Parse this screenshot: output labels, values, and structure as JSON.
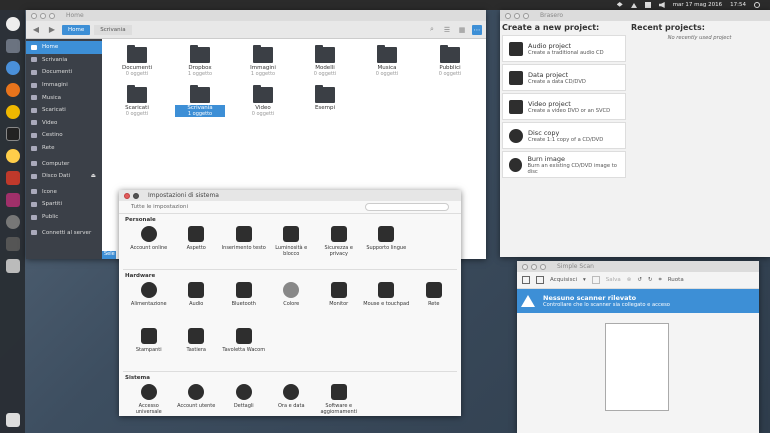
{
  "panel": {
    "date": "mar 17 mag 2016",
    "time": "17:54"
  },
  "files": {
    "title": "Home",
    "crumb_home": "Home",
    "crumb_desktop": "Scrivania",
    "sidebar": [
      "Home",
      "Scrivania",
      "Documenti",
      "Immagini",
      "Musica",
      "Scaricati",
      "Video",
      "Cestino",
      "Rete",
      "Computer",
      "Disco Dati",
      "Icone",
      "Spartiti",
      "Public",
      "Connetti al server"
    ],
    "items": [
      {
        "name": "Documenti",
        "sub": "0 oggetti"
      },
      {
        "name": "Dropbox",
        "sub": "1 oggetto"
      },
      {
        "name": "Immagini",
        "sub": "1 oggetto"
      },
      {
        "name": "Modelli",
        "sub": "0 oggetti"
      },
      {
        "name": "Musica",
        "sub": "0 oggetti"
      },
      {
        "name": "Pubblici",
        "sub": "0 oggetti"
      },
      {
        "name": "Scaricati",
        "sub": "0 oggetti"
      },
      {
        "name": "Scrivania",
        "sub": "1 oggetto"
      },
      {
        "name": "Video",
        "sub": "0 oggetti"
      },
      {
        "name": "Esempi",
        "sub": ""
      }
    ],
    "status": "Sele"
  },
  "brasero": {
    "title": "Brasero",
    "create_heading": "Create a new project:",
    "recent_heading": "Recent projects:",
    "recent_empty": "No recently used project",
    "projects": [
      {
        "title": "Audio project",
        "desc": "Create a traditional audio CD"
      },
      {
        "title": "Data project",
        "desc": "Create a data CD/DVD"
      },
      {
        "title": "Video project",
        "desc": "Create a video DVD or an SVCD"
      },
      {
        "title": "Disc copy",
        "desc": "Create 1:1 copy of a CD/DVD"
      },
      {
        "title": "Burn image",
        "desc": "Burn an existing CD/DVD image to disc"
      }
    ]
  },
  "settings": {
    "title": "Impostazioni di sistema",
    "all": "Tutte le impostazioni",
    "sections": [
      {
        "name": "Personale",
        "items": [
          "Account online",
          "Aspetto",
          "Inserimento testo",
          "Luminosità e blocco",
          "Sicurezza e privacy",
          "Supporto lingue"
        ]
      },
      {
        "name": "Hardware",
        "items": [
          "Alimentazione",
          "Audio",
          "Bluetooth",
          "Colore",
          "Monitor",
          "Mouse e touchpad",
          "Rete",
          "Stampanti",
          "Tastiera",
          "Tavoletta Wacom"
        ]
      },
      {
        "name": "Sistema",
        "items": [
          "Accesso universale",
          "Account utente",
          "Dettagli",
          "Ora e data",
          "Software e aggiornamenti"
        ]
      }
    ]
  },
  "scan": {
    "title": "Simple Scan",
    "acquire": "Acquisisci",
    "save": "Salva",
    "rotate": "Ruota",
    "alert_title": "Nessuno scanner rilevato",
    "alert_text": "Controllare che lo scanner sia collegato e acceso"
  }
}
